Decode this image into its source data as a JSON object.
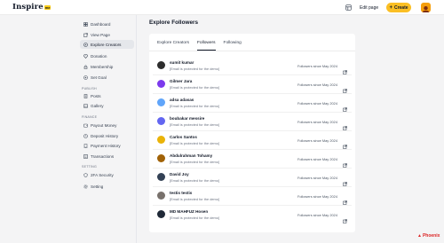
{
  "brand": {
    "name": "Inspire",
    "badge": "me"
  },
  "header": {
    "edit_label": "Edit page",
    "create_label": "Create"
  },
  "sidebar": {
    "items": [
      {
        "label": "Dashboard",
        "icon": "dashboard-icon"
      },
      {
        "label": "View Page",
        "icon": "external-link-icon"
      },
      {
        "label": "Explore Creators",
        "icon": "compass-icon"
      },
      {
        "label": "Donation",
        "icon": "heart-icon"
      },
      {
        "label": "Membership",
        "icon": "lock-icon"
      },
      {
        "label": "Set Goal",
        "icon": "target-icon"
      },
      {
        "label": "Posts",
        "icon": "document-icon"
      },
      {
        "label": "Gallery",
        "icon": "image-icon"
      },
      {
        "label": "Payout Money",
        "icon": "wallet-icon"
      },
      {
        "label": "Deposit History",
        "icon": "clock-icon"
      },
      {
        "label": "Payment History",
        "icon": "receipt-icon"
      },
      {
        "label": "Transactions",
        "icon": "transactions-icon"
      },
      {
        "label": "2FA Security",
        "icon": "shield-icon"
      },
      {
        "label": "Setting",
        "icon": "gear-icon"
      }
    ],
    "sections": {
      "publish": "PUBLISH",
      "finance": "FINANCE",
      "setting": "SETTING"
    }
  },
  "main": {
    "title": "Explore Followers",
    "tabs": [
      {
        "label": "Explore Creators"
      },
      {
        "label": "Followers"
      },
      {
        "label": "Following"
      }
    ],
    "followers": [
      {
        "name": "sumit kumar",
        "email": "[Email is protected for the demo]",
        "since": "Followers since May 2024",
        "avatar_color": "#2d2d2d"
      },
      {
        "name": "Gilmer Jara",
        "email": "[Email is protected for the demo]",
        "since": "Followers since May 2024",
        "avatar_color": "#7c3aed"
      },
      {
        "name": "adsa adasas",
        "email": "[Email is protected for the demo]",
        "since": "Followers since May 2024",
        "avatar_color": "#60a5fa"
      },
      {
        "name": "boubakar messire",
        "email": "[Email is protected for the demo]",
        "since": "Followers since May 2024",
        "avatar_color": "#6366f1"
      },
      {
        "name": "Carlos Santos",
        "email": "[Email is protected for the demo]",
        "since": "Followers since May 2024",
        "avatar_color": "#eab308"
      },
      {
        "name": "Abdulrahman Tohamy",
        "email": "[Email is protected for the demo]",
        "since": "Followers since May 2024",
        "avatar_color": "#a16207"
      },
      {
        "name": "David Joy",
        "email": "[Email is protected for the demo]",
        "since": "Followers since May 2024",
        "avatar_color": "#334155"
      },
      {
        "name": "testis testis",
        "email": "[Email is protected for the demo]",
        "since": "Followers since May 2024",
        "avatar_color": "#78716c"
      },
      {
        "name": "MD MAHFUZ Hosen",
        "email": "[Email is protected for the demo]",
        "since": "Followers since May 2024",
        "avatar_color": "#1f2937"
      }
    ]
  },
  "watermark": {
    "text": "Phoenix"
  },
  "colors": {
    "accent": "#fbbf24",
    "background": "#f4f4f5",
    "card": "#ffffff"
  }
}
